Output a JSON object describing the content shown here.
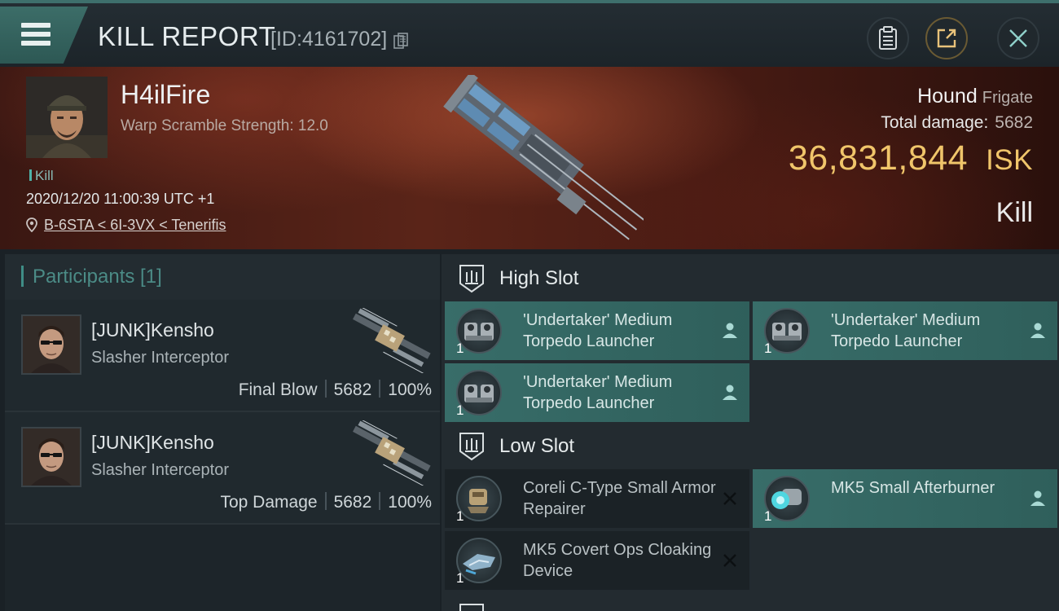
{
  "header": {
    "title": "KILL REPORT",
    "report_id": "[ID:4161702]"
  },
  "victim": {
    "name": "H4ilFire",
    "subtitle": "Warp Scramble Strength: 12.0",
    "tag": "Kill",
    "datetime": "2020/12/20 11:00:39 UTC +1",
    "location": "B-6STA < 6I-3VX < Tenerifis",
    "ship_name": "Hound",
    "ship_class": "Frigate",
    "total_damage_label": "Total damage:",
    "total_damage": "5682",
    "isk_value": "36,831,844",
    "isk_unit": "ISK",
    "result": "Kill"
  },
  "participants": {
    "label": "Participants [1]",
    "items": [
      {
        "name": "[JUNK]Kensho",
        "ship": "Slasher Interceptor",
        "stat_label": "Final Blow",
        "damage": "5682",
        "percent": "100%"
      },
      {
        "name": "[JUNK]Kensho",
        "ship": "Slasher Interceptor",
        "stat_label": "Top Damage",
        "damage": "5682",
        "percent": "100%"
      }
    ]
  },
  "fitting": {
    "high_slot_label": "High Slot",
    "low_slot_label": "Low Slot",
    "high_modules": [
      {
        "name": "'Undertaker' Medium Torpedo Launcher",
        "qty": "1",
        "state": "dropped"
      },
      {
        "name": "'Undertaker' Medium Torpedo Launcher",
        "qty": "1",
        "state": "dropped"
      },
      {
        "name": "'Undertaker' Medium Torpedo Launcher",
        "qty": "1",
        "state": "dropped"
      }
    ],
    "low_modules": [
      {
        "name": "Coreli C-Type Small Armor Repairer",
        "qty": "1",
        "state": "destroyed"
      },
      {
        "name": "MK5 Small Afterburner",
        "qty": "1",
        "state": "dropped"
      },
      {
        "name": "MK5 Covert Ops Cloaking Device",
        "qty": "1",
        "state": "destroyed"
      }
    ]
  },
  "colors": {
    "accent_teal": "#386d69",
    "isk_gold": "#f0c56a",
    "hero_red": "#5a2418"
  }
}
